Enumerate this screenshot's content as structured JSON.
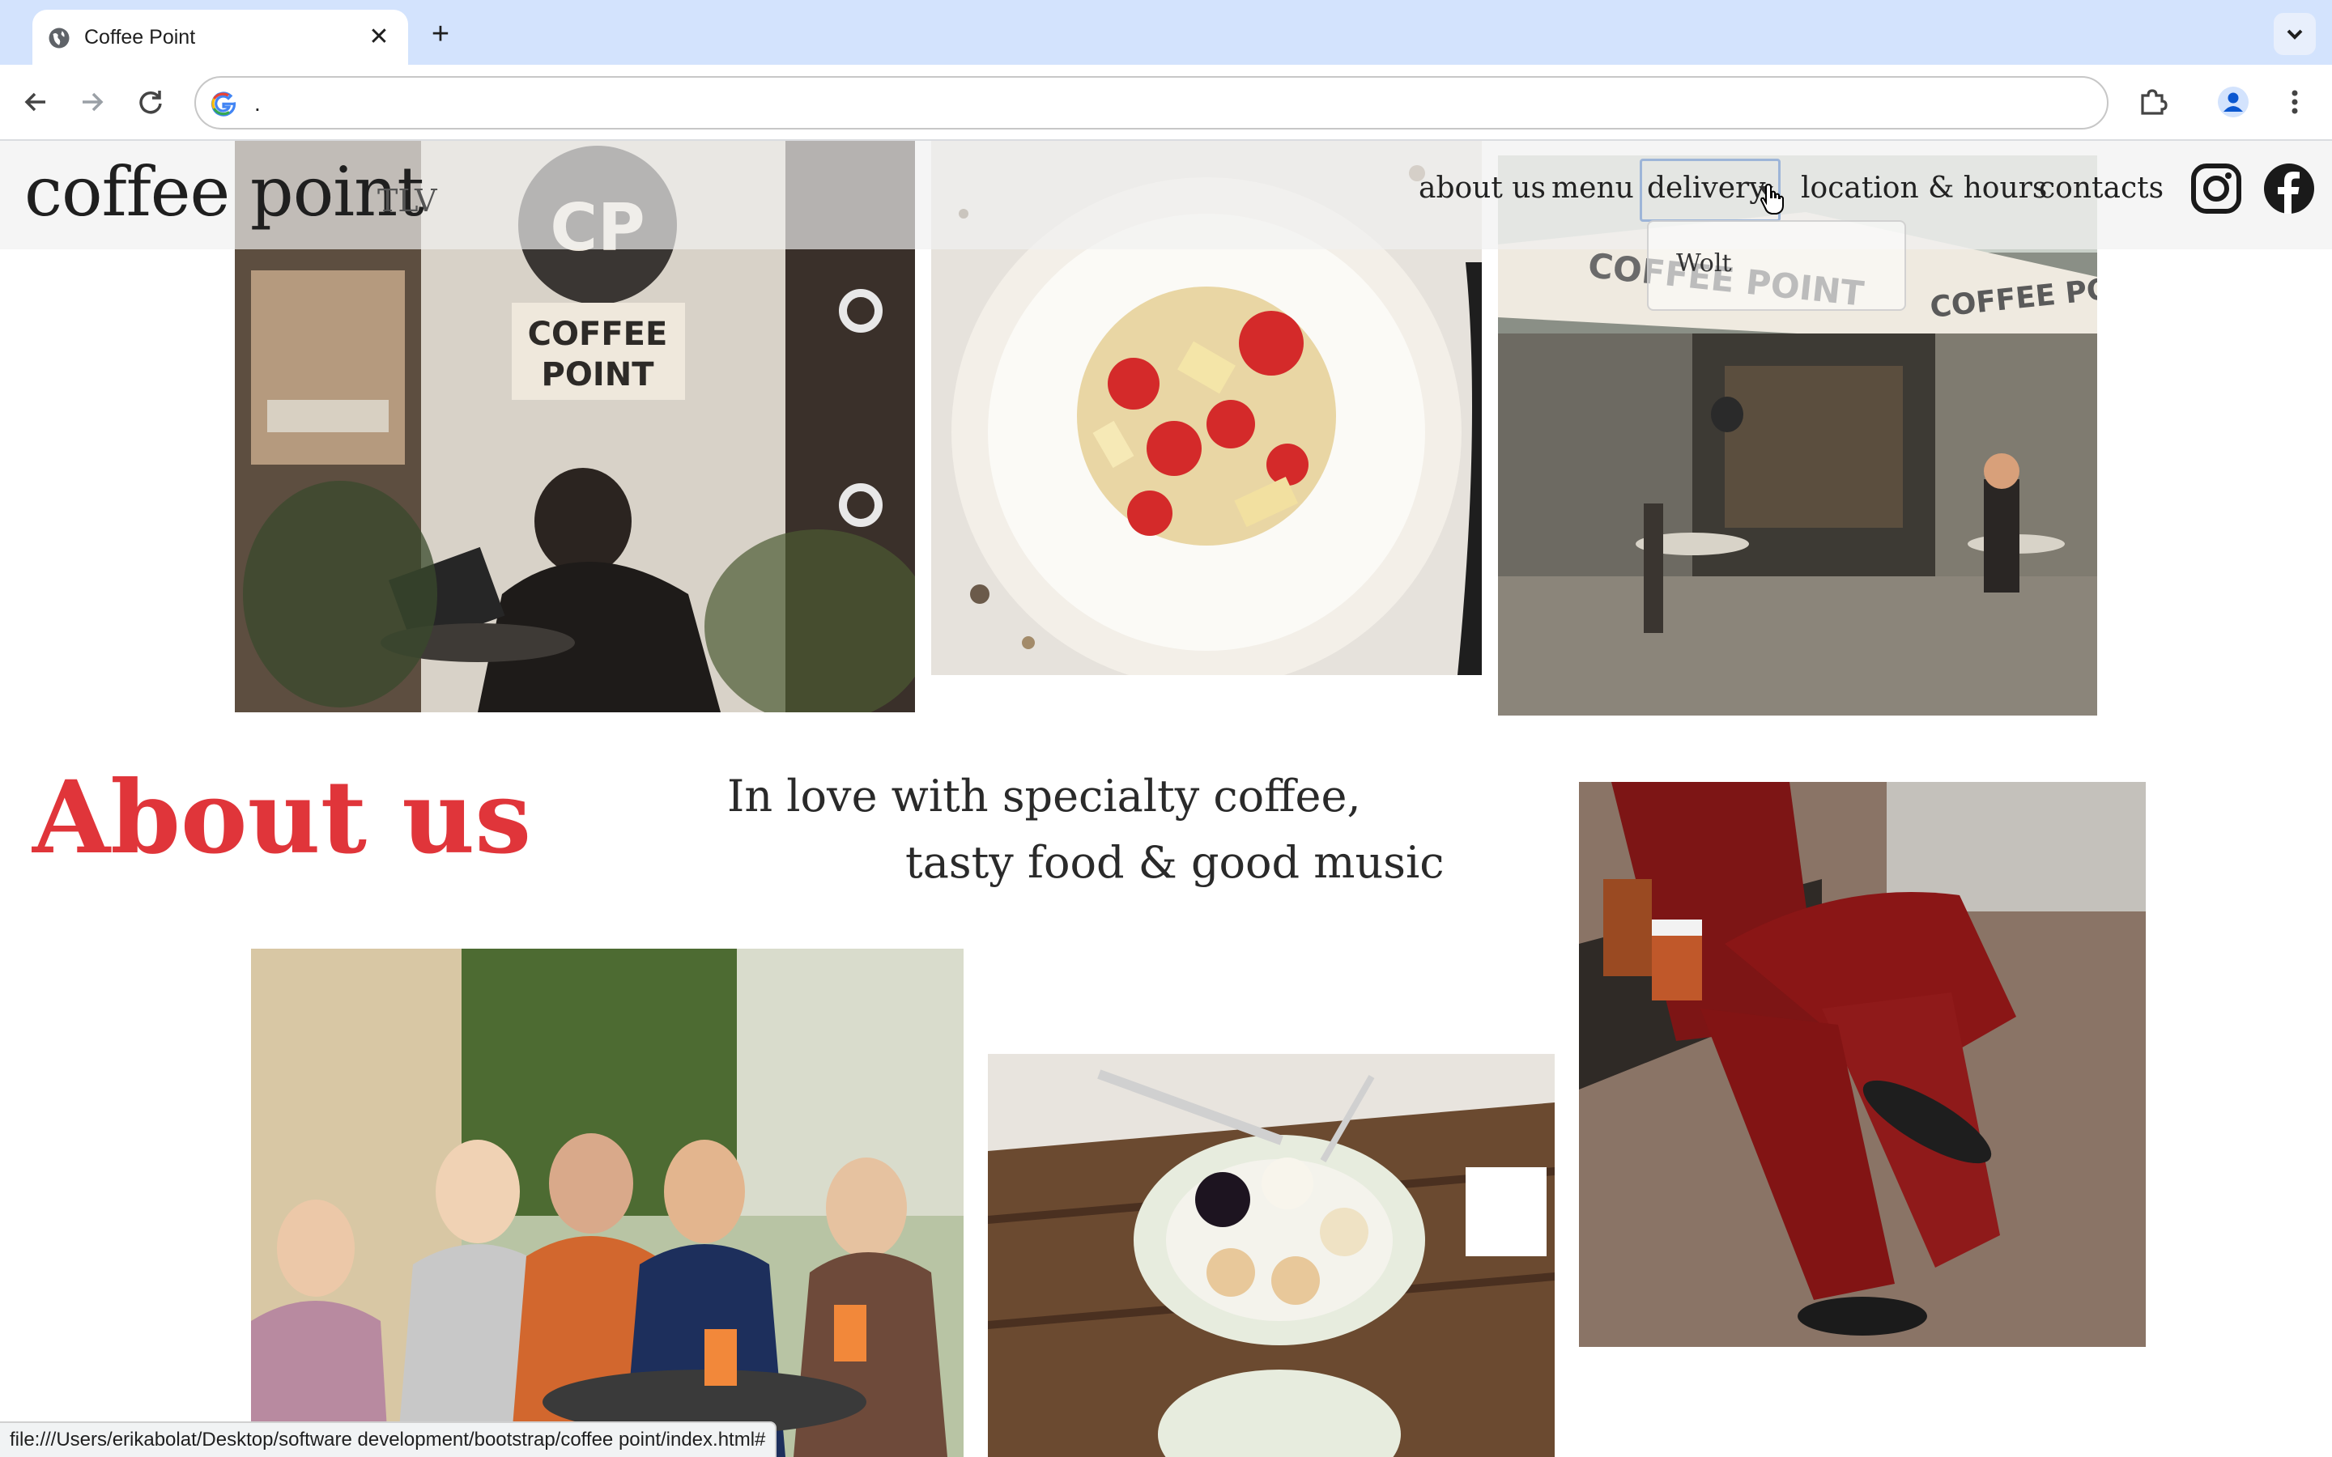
{
  "browser": {
    "tab_title": "Coffee Point",
    "close_glyph": "✕",
    "new_tab_glyph": "+",
    "address_value": ".",
    "status_url": "file:///Users/erikabolat/Desktop/software development/bootstrap/coffee point/index.html#"
  },
  "site": {
    "brand": "coffee point",
    "brand_sub": "TLV",
    "nav": {
      "about": "about us",
      "menu": "menu",
      "delivery": "delivery",
      "location": "location & hours",
      "contacts": "contacts"
    },
    "delivery_dropdown": [
      "Wolt"
    ],
    "social": [
      "instagram-icon",
      "facebook-icon"
    ]
  },
  "photo_signs": {
    "logo_monogram": "CP",
    "logo_text_1": "COFFEE",
    "logo_text_2": "POINT",
    "umbrella_left": "COFFEE POINT",
    "umbrella_right": "COFFEE POINT"
  },
  "about": {
    "title": "About us",
    "tagline_line1": "In love with specialty coffee,",
    "tagline_line2": "tasty food & good music"
  },
  "colors": {
    "accent_red": "#e0353a",
    "tab_strip": "#d3e3fd",
    "dropdown_border": "#9db5d8"
  }
}
